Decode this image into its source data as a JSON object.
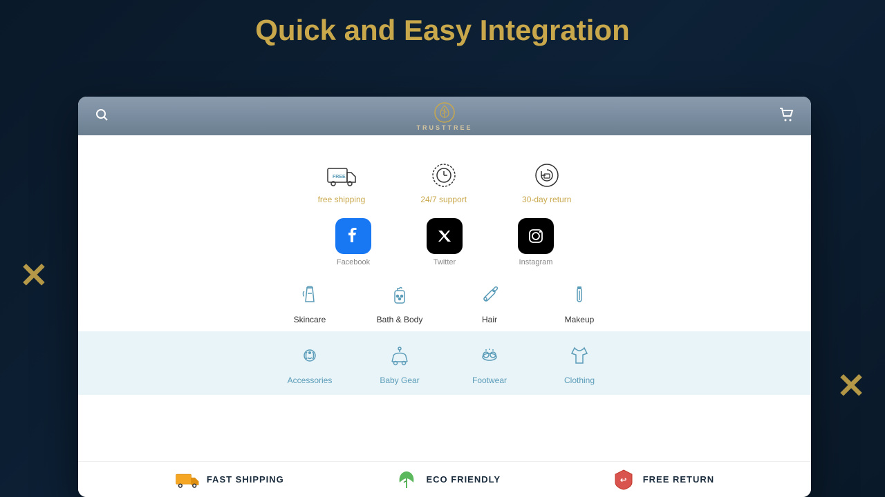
{
  "page": {
    "title_part1": "Quick and ",
    "title_part2": "Easy Integration"
  },
  "header": {
    "logo_text": "TRUSTTREE",
    "search_label": "search",
    "cart_label": "cart"
  },
  "features": [
    {
      "id": "free-shipping",
      "label": "free shipping",
      "icon": "🚚"
    },
    {
      "id": "support",
      "label": "24/7 support",
      "icon": "🕐"
    },
    {
      "id": "return",
      "label": "30-day return",
      "icon": "↩"
    }
  ],
  "socials": [
    {
      "id": "facebook",
      "label": "Facebook",
      "type": "fb"
    },
    {
      "id": "twitter",
      "label": "Twitter",
      "type": "tw"
    },
    {
      "id": "instagram",
      "label": "Instagram",
      "type": "ig"
    }
  ],
  "categories_row1": [
    {
      "id": "skincare",
      "label": "Skincare",
      "icon": "🏷️"
    },
    {
      "id": "bath-body",
      "label": "Bath & Body",
      "icon": "🧴"
    },
    {
      "id": "hair",
      "label": "Hair",
      "icon": "💈"
    },
    {
      "id": "makeup",
      "label": "Makeup",
      "icon": "💄"
    }
  ],
  "categories_row2": [
    {
      "id": "accessories",
      "label": "Accessories",
      "icon": "🎀"
    },
    {
      "id": "baby-gear",
      "label": "Baby Gear",
      "icon": "🍼"
    },
    {
      "id": "footwear",
      "label": "Footwear",
      "icon": "👓"
    },
    {
      "id": "clothing",
      "label": "Clothing",
      "icon": "👕"
    }
  ],
  "badges": [
    {
      "id": "fast-shipping",
      "label": "FAST SHIPPING",
      "icon": "🚚",
      "color": "#f5a623"
    },
    {
      "id": "eco-friendly",
      "label": "ECO FRIENDLY",
      "icon": "🌿",
      "color": "#5cb85c"
    },
    {
      "id": "free-return",
      "label": "FREE RETURN",
      "icon": "🛡️",
      "color": "#d9534f"
    }
  ],
  "decorations": {
    "x_left": "✕",
    "x_right": "✕"
  }
}
